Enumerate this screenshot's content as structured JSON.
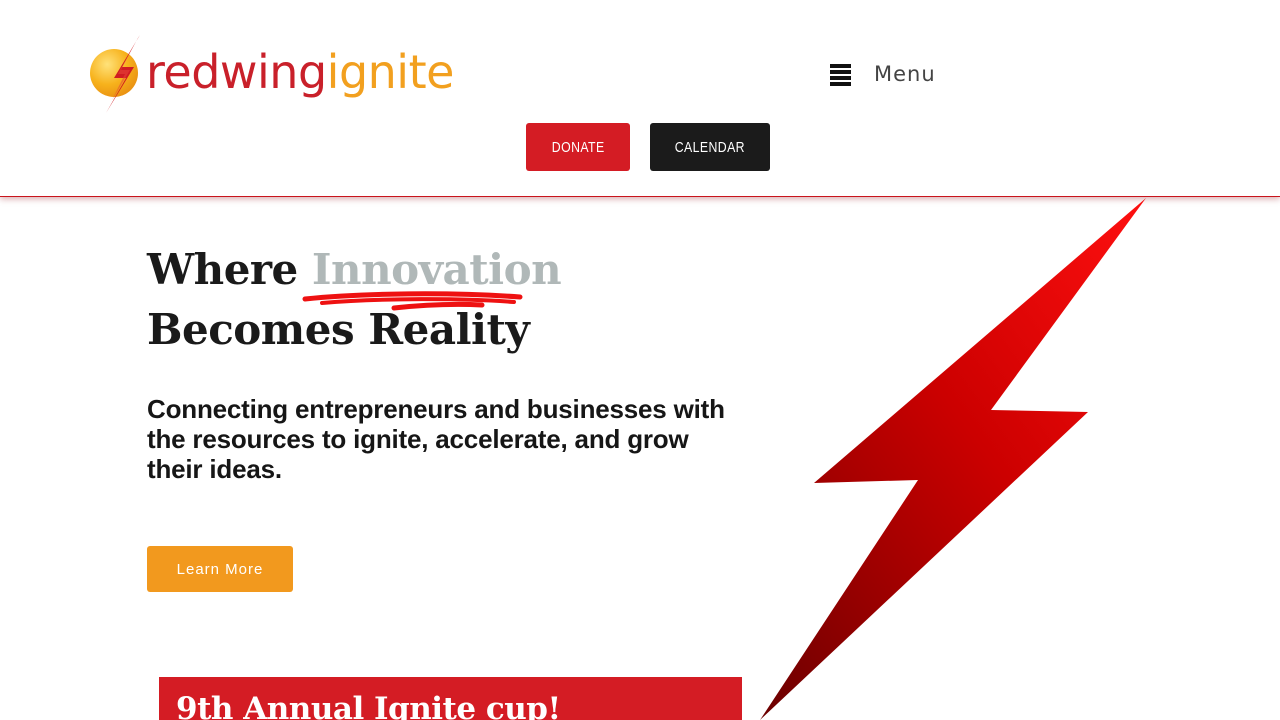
{
  "header": {
    "logo": {
      "word_red": "redwing",
      "word_orange": "ignite"
    },
    "menu": {
      "label": "Menu",
      "icon": "hamburger-icon"
    },
    "donate_label": "DONATE",
    "calendar_label": "CALENDAR"
  },
  "hero": {
    "headline_prefix": "Where",
    "headline_accent": "Innovation",
    "headline_line2": "Becomes Reality",
    "subheadline": "Connecting entrepreneurs and businesses with the resources to ignite, accelerate, and grow their ideas.",
    "cta_label": "Learn More",
    "graphic": "lightning-bolt-graphic"
  },
  "banner": {
    "text": "9th Annual Ignite cup!"
  },
  "colors": {
    "brand_red": "#d41c24",
    "brand_orange": "#f2991e",
    "dark": "#1b1b1b",
    "accent_gray": "#b0b8b8"
  }
}
